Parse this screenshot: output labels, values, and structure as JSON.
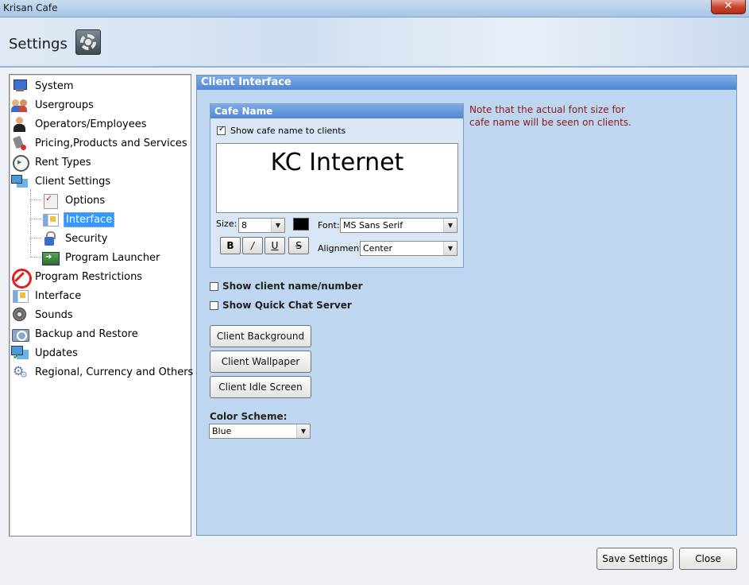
{
  "window": {
    "title": "Krisan Cafe",
    "close_glyph": "✕"
  },
  "header": {
    "title": "Settings",
    "icon": "settings-gear-icon"
  },
  "tree": {
    "items": [
      {
        "label": "System",
        "icon": "monitor-icon"
      },
      {
        "label": "Usergroups",
        "icon": "users-icon"
      },
      {
        "label": "Operators/Employees",
        "icon": "operator-icon"
      },
      {
        "label": "Pricing,Products and Services",
        "icon": "pricing-icon"
      },
      {
        "label": "Rent Types",
        "icon": "clock-icon"
      },
      {
        "label": "Client Settings",
        "icon": "clients-icon"
      },
      {
        "label": "Options",
        "icon": "options-icon"
      },
      {
        "label": "Interface",
        "icon": "interface-icon",
        "selected": true
      },
      {
        "label": "Security",
        "icon": "lock-icon"
      },
      {
        "label": "Program Launcher",
        "icon": "launcher-icon"
      },
      {
        "label": "Program Restrictions",
        "icon": "no-entry-icon"
      },
      {
        "label": "Interface",
        "icon": "interface-icon"
      },
      {
        "label": "Sounds",
        "icon": "speaker-icon"
      },
      {
        "label": "Backup and Restore",
        "icon": "backup-icon"
      },
      {
        "label": "Updates",
        "icon": "updates-icon"
      },
      {
        "label": "Regional, Currency and Others",
        "icon": "gears-icon"
      }
    ]
  },
  "panel": {
    "title": "Client Interface",
    "cafe_name": {
      "group_title": "Cafe Name",
      "show_to_clients_label": "Show cafe name to clients",
      "show_to_clients_checked": true,
      "preview_text": "KC Internet",
      "size_label": "Size:",
      "size_value": "8",
      "font_color": "#000000",
      "font_label": "Font:",
      "font_value": "MS Sans Serif",
      "bold": "B",
      "italic": "/",
      "underline": "U",
      "strike": "S",
      "alignment_label": "Alignment:",
      "alignment_value": "Center"
    },
    "note": "Note that the actual font size for cafe name will be seen on clients.",
    "show_client_name_label": "Show client name/number",
    "show_client_name_checked": false,
    "show_quick_chat_label": "Show Quick Chat Server",
    "show_quick_chat_checked": false,
    "buttons": {
      "background": "Client Background",
      "wallpaper": "Client Wallpaper",
      "idle": "Client Idle Screen"
    },
    "color_scheme_label": "Color Scheme:",
    "color_scheme_value": "Blue"
  },
  "footer": {
    "save": "Save Settings",
    "close": "Close"
  }
}
